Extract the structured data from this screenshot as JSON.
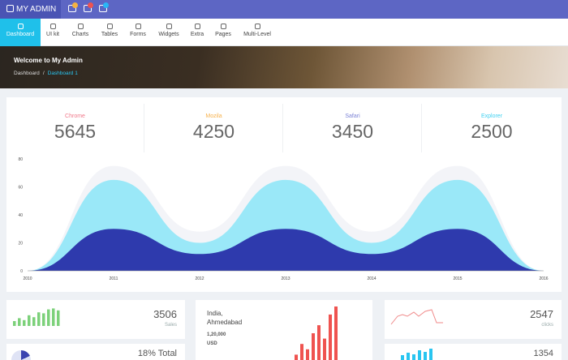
{
  "brand": {
    "title": "MY ADMIN"
  },
  "topbar": {
    "icons": [
      {
        "name": "mail-icon",
        "badge_color": "#f5b342"
      },
      {
        "name": "tasks-icon",
        "badge_color": "#ef5350"
      },
      {
        "name": "bell-icon",
        "badge_color": "#29b6f6"
      }
    ]
  },
  "nav": [
    {
      "label": "Dashboard",
      "icon": "home-icon"
    },
    {
      "label": "UI kit",
      "icon": "magnet-icon"
    },
    {
      "label": "Charts",
      "icon": "pie-chart-icon"
    },
    {
      "label": "Tables",
      "icon": "table-icon"
    },
    {
      "label": "Forms",
      "icon": "edit-icon"
    },
    {
      "label": "Widgets",
      "icon": "widget-icon"
    },
    {
      "label": "Extra",
      "icon": "target-icon"
    },
    {
      "label": "Pages",
      "icon": "copy-icon"
    },
    {
      "label": "Multi-Level",
      "icon": "layers-icon"
    }
  ],
  "hero": {
    "title": "Welcome to My Admin",
    "breadcrumb": [
      "Dashboard",
      "Dashboard 1"
    ]
  },
  "stats": [
    {
      "label": "Chrome",
      "value": "5645",
      "color": "#f0788a"
    },
    {
      "label": "Mozila",
      "value": "4250",
      "color": "#f7b14b"
    },
    {
      "label": "Safari",
      "value": "3450",
      "color": "#7b82d6"
    },
    {
      "label": "Explorer",
      "value": "2500",
      "color": "#3fd0f0"
    }
  ],
  "chart_data": {
    "type": "area",
    "x": [
      "2010",
      "2011",
      "2012",
      "2013",
      "2014",
      "2015",
      "2016"
    ],
    "ylim": [
      0,
      80
    ],
    "yticks": [
      "0",
      "20",
      "40",
      "60",
      "80"
    ],
    "series": [
      {
        "values": [
          0,
          75,
          28,
          75,
          28,
          75,
          0
        ],
        "color": "#f3f4f8"
      },
      {
        "values": [
          0,
          65,
          20,
          65,
          20,
          65,
          0
        ],
        "color": "#9ae8f8"
      },
      {
        "values": [
          0,
          30,
          12,
          30,
          12,
          30,
          0
        ],
        "color": "#2e3aad"
      }
    ]
  },
  "widgets": {
    "sales": {
      "value": "3506",
      "label": "Sales",
      "bars": [
        0.25,
        0.4,
        0.3,
        0.55,
        0.45,
        0.7,
        0.65,
        0.85,
        0.9,
        0.8
      ]
    },
    "location": {
      "city": "India,",
      "city2": "Ahmedabad",
      "amount": "1,20,000",
      "currency": "USD",
      "bars": [
        0.1,
        0.3,
        0.2,
        0.5,
        0.65,
        0.4,
        0.85,
        1.0
      ]
    },
    "clicks": {
      "value": "2547",
      "label": "clicks"
    },
    "total": {
      "value": "18% Total"
    },
    "last": {
      "value": "1354"
    }
  }
}
